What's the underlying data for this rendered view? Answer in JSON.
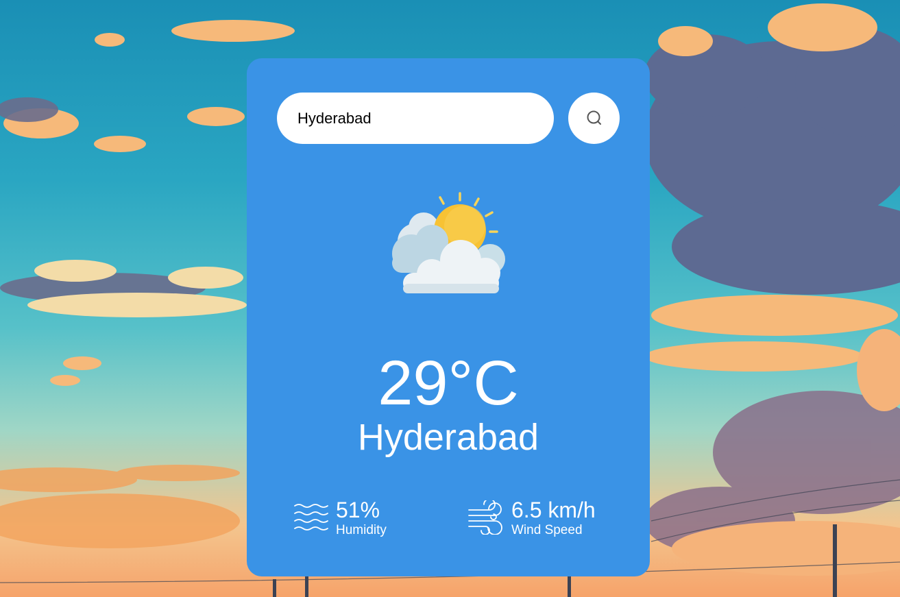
{
  "colors": {
    "card": "#3a93e6",
    "text": "#ffffff",
    "sun": "#f7c234",
    "cloud": "#e6eef3"
  },
  "search": {
    "value": "Hyderabad",
    "button_icon": "search-icon"
  },
  "weather": {
    "icon": "sun-behind-clouds-icon",
    "temperature": "29°C",
    "city": "Hyderabad"
  },
  "details": {
    "humidity": {
      "icon": "humidity-waves-icon",
      "value": "51%",
      "label": "Humidity"
    },
    "wind": {
      "icon": "wind-icon",
      "value": "6.5 km/h",
      "label": "Wind Speed"
    }
  }
}
